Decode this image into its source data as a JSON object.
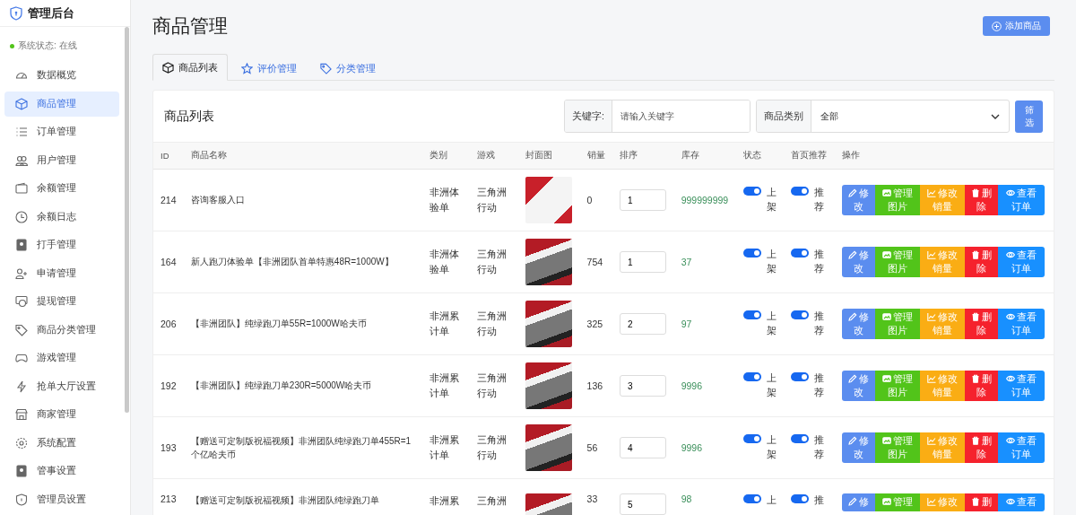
{
  "brand": {
    "title": "管理后台"
  },
  "system_status": {
    "text": "系统状态: 在线",
    "online": true
  },
  "sidebar": {
    "items": [
      {
        "label": "数据概览",
        "selected": false
      },
      {
        "label": "商品管理",
        "selected": true
      },
      {
        "label": "订单管理",
        "selected": false
      },
      {
        "label": "用户管理",
        "selected": false
      },
      {
        "label": "余额管理",
        "selected": false
      },
      {
        "label": "余额日志",
        "selected": false
      },
      {
        "label": "打手管理",
        "selected": false
      },
      {
        "label": "申请管理",
        "selected": false
      },
      {
        "label": "提现管理",
        "selected": false
      },
      {
        "label": "商品分类管理",
        "selected": false
      },
      {
        "label": "游戏管理",
        "selected": false
      },
      {
        "label": "抢单大厅设置",
        "selected": false
      },
      {
        "label": "商家管理",
        "selected": false
      },
      {
        "label": "系统配置",
        "selected": false
      },
      {
        "label": "管事设置",
        "selected": false
      },
      {
        "label": "管理员设置",
        "selected": false
      }
    ]
  },
  "page": {
    "title": "商品管理",
    "add_button": "添加商品"
  },
  "tabs": [
    {
      "label": "商品列表",
      "selected": true
    },
    {
      "label": "评价管理",
      "selected": false
    },
    {
      "label": "分类管理",
      "selected": false
    }
  ],
  "card": {
    "title": "商品列表",
    "filters": {
      "keyword_label": "关键字:",
      "keyword_placeholder": "请输入关键字",
      "category_label": "商品类别",
      "category_value": "全部",
      "filter_button": "筛选"
    },
    "table": {
      "columns": [
        "ID",
        "商品名称",
        "类别",
        "游戏",
        "封面图",
        "销量",
        "排序",
        "库存",
        "状态",
        "首页推荐",
        "操作"
      ],
      "rows": [
        {
          "id": "214",
          "name": "咨询客服入口",
          "category": "非洲体验单",
          "game": "三角洲行动",
          "sales": "0",
          "sort": "1",
          "stock": "999999999",
          "status": {
            "on": true,
            "label": "上架"
          },
          "recommend": {
            "on": true,
            "label": "推荐"
          },
          "actions": [
            {
              "kind": "edit",
              "label": "修改"
            },
            {
              "kind": "images",
              "label": "管理图片"
            },
            {
              "kind": "sales",
              "label": "修改销量"
            },
            {
              "kind": "delete",
              "label": "删除"
            },
            {
              "kind": "orders",
              "label": "查看订单"
            }
          ]
        },
        {
          "id": "164",
          "name": "新人跑刀体验单【非洲团队首单特惠48R=1000W】",
          "category": "非洲体验单",
          "game": "三角洲行动",
          "sales": "754",
          "sort": "1",
          "stock": "37",
          "status": {
            "on": true,
            "label": "上架"
          },
          "recommend": {
            "on": true,
            "label": "推荐"
          },
          "actions": [
            {
              "kind": "edit",
              "label": "修改"
            },
            {
              "kind": "images",
              "label": "管理图片"
            },
            {
              "kind": "sales",
              "label": "修改销量"
            },
            {
              "kind": "delete",
              "label": "删除"
            },
            {
              "kind": "orders",
              "label": "查看订单"
            }
          ]
        },
        {
          "id": "206",
          "name": "【非洲团队】纯绿跑刀单55R=1000W哈夫币",
          "category": "非洲累计单",
          "game": "三角洲行动",
          "sales": "325",
          "sort": "2",
          "stock": "97",
          "status": {
            "on": true,
            "label": "上架"
          },
          "recommend": {
            "on": true,
            "label": "推荐"
          },
          "actions": [
            {
              "kind": "edit",
              "label": "修改"
            },
            {
              "kind": "images",
              "label": "管理图片"
            },
            {
              "kind": "sales",
              "label": "修改销量"
            },
            {
              "kind": "delete",
              "label": "删除"
            },
            {
              "kind": "orders",
              "label": "查看订单"
            }
          ]
        },
        {
          "id": "192",
          "name": "【非洲团队】纯绿跑刀单230R=5000W哈夫币",
          "category": "非洲累计单",
          "game": "三角洲行动",
          "sales": "136",
          "sort": "3",
          "stock": "9996",
          "status": {
            "on": true,
            "label": "上架"
          },
          "recommend": {
            "on": true,
            "label": "推荐"
          },
          "actions": [
            {
              "kind": "edit",
              "label": "修改"
            },
            {
              "kind": "images",
              "label": "管理图片"
            },
            {
              "kind": "sales",
              "label": "修改销量"
            },
            {
              "kind": "delete",
              "label": "删除"
            },
            {
              "kind": "orders",
              "label": "查看订单"
            }
          ]
        },
        {
          "id": "193",
          "name": "【赠送可定制版祝福视频】非洲团队纯绿跑刀单455R=1个亿哈夫币",
          "category": "非洲累计单",
          "game": "三角洲行动",
          "sales": "56",
          "sort": "4",
          "stock": "9996",
          "status": {
            "on": true,
            "label": "上架"
          },
          "recommend": {
            "on": true,
            "label": "推荐"
          },
          "actions": [
            {
              "kind": "edit",
              "label": "修改"
            },
            {
              "kind": "images",
              "label": "管理图片"
            },
            {
              "kind": "sales",
              "label": "修改销量"
            },
            {
              "kind": "delete",
              "label": "删除"
            },
            {
              "kind": "orders",
              "label": "查看订单"
            }
          ]
        },
        {
          "id": "213",
          "name": "【赠送可定制版祝福视频】非洲团队纯绿跑刀单",
          "category": "非洲累",
          "game": "三角洲",
          "sales": "33",
          "sort": "5",
          "stock": "98",
          "status": {
            "on": true,
            "label": "上"
          },
          "recommend": {
            "on": true,
            "label": "推"
          },
          "actions": [
            {
              "kind": "edit",
              "label": "修"
            },
            {
              "kind": "images",
              "label": "管理"
            },
            {
              "kind": "sales",
              "label": "修改"
            },
            {
              "kind": "delete",
              "label": "删"
            },
            {
              "kind": "orders",
              "label": "查看"
            }
          ]
        }
      ]
    }
  }
}
